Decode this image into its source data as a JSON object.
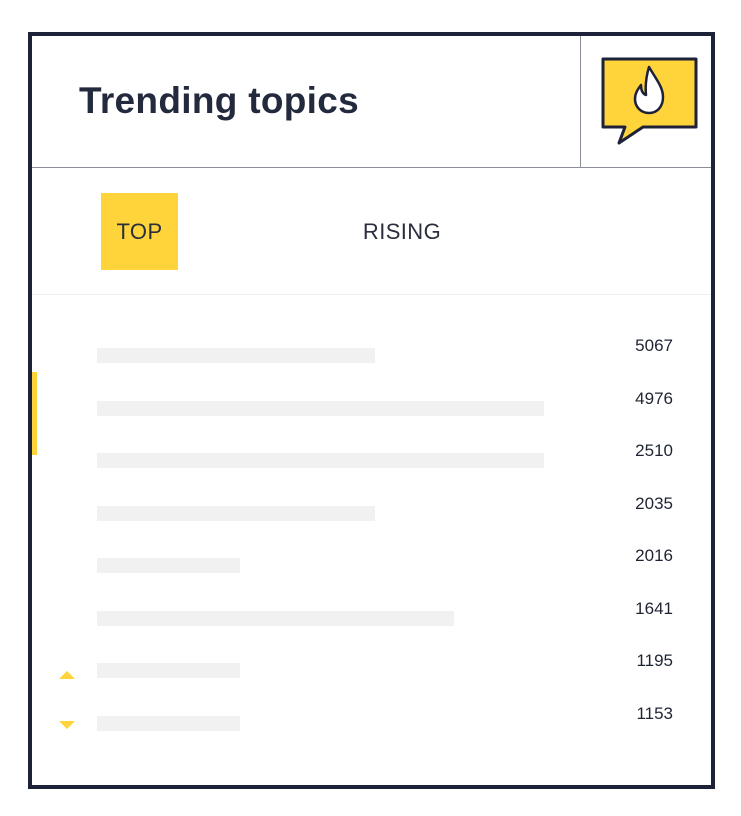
{
  "widget": {
    "title": "Trending topics",
    "brand_icon": "flame-speech-bubble-icon",
    "accent_color": "#ffd43b",
    "border_color": "#1e2238"
  },
  "tabs": [
    {
      "label": "TOP",
      "active": true
    },
    {
      "label": "RISING",
      "active": false
    }
  ],
  "topics": [
    {
      "count": "5067"
    },
    {
      "count": "4976"
    },
    {
      "count": "2510"
    },
    {
      "count": "2035"
    },
    {
      "count": "2016"
    },
    {
      "count": "1641"
    },
    {
      "count": "1195"
    },
    {
      "count": "1153"
    }
  ],
  "scroll_controls": {
    "up_icon": "arrow-up-icon",
    "down_icon": "arrow-down-icon"
  }
}
